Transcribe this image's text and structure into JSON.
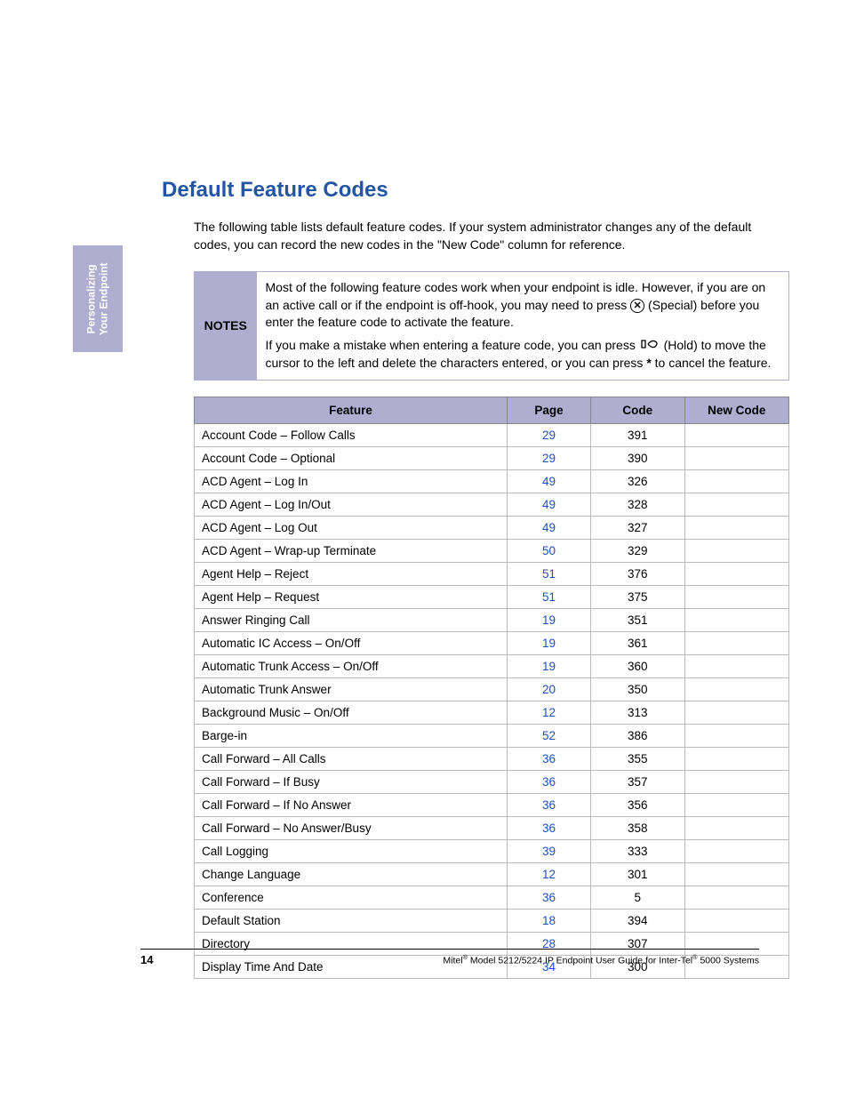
{
  "sideTab": {
    "line1": "Personalizing",
    "line2": "Your Endpoint"
  },
  "title": "Default Feature Codes",
  "intro": "The following table lists default feature codes. If your system administrator changes any of the default codes, you can record the new codes in the \"New Code\" column for reference.",
  "notes": {
    "label": "NOTES",
    "p1a": "Most of the following feature codes work when your endpoint is idle. However, if you are on an active call or if the endpoint is off-hook, you may need to press ",
    "p1b": " (Special) before you enter the feature code to activate the feature.",
    "p2a": "If you make a mistake when entering a feature code, you can press ",
    "p2b": " (Hold) to move the cursor to the left and delete the characters entered, or you can press ",
    "p2c": " to cancel the feature.",
    "star": "*"
  },
  "table": {
    "headers": {
      "feature": "Feature",
      "page": "Page",
      "code": "Code",
      "newCode": "New Code"
    },
    "rows": [
      {
        "feature": "Account Code – Follow Calls",
        "page": "29",
        "code": "391"
      },
      {
        "feature": "Account Code – Optional",
        "page": "29",
        "code": "390"
      },
      {
        "feature": "ACD Agent – Log In",
        "page": "49",
        "code": "326"
      },
      {
        "feature": "ACD Agent – Log In/Out",
        "page": "49",
        "code": "328"
      },
      {
        "feature": "ACD Agent – Log Out",
        "page": "49",
        "code": "327"
      },
      {
        "feature": "ACD Agent – Wrap-up Terminate",
        "page": "50",
        "code": "329"
      },
      {
        "feature": "Agent Help – Reject",
        "page": "51",
        "code": "376"
      },
      {
        "feature": "Agent Help – Request",
        "page": "51",
        "code": "375"
      },
      {
        "feature": "Answer Ringing Call",
        "page": "19",
        "code": "351"
      },
      {
        "feature": "Automatic IC Access – On/Off",
        "page": "19",
        "code": "361"
      },
      {
        "feature": "Automatic Trunk Access – On/Off",
        "page": "19",
        "code": "360"
      },
      {
        "feature": "Automatic Trunk Answer",
        "page": "20",
        "code": "350"
      },
      {
        "feature": "Background Music – On/Off",
        "page": "12",
        "code": "313"
      },
      {
        "feature": "Barge-in",
        "page": "52",
        "code": "386"
      },
      {
        "feature": "Call Forward – All Calls",
        "page": "36",
        "code": "355"
      },
      {
        "feature": "Call Forward – If Busy",
        "page": "36",
        "code": "357"
      },
      {
        "feature": "Call Forward – If No Answer",
        "page": "36",
        "code": "356"
      },
      {
        "feature": "Call Forward – No Answer/Busy",
        "page": "36",
        "code": "358"
      },
      {
        "feature": "Call Logging",
        "page": "39",
        "code": "333"
      },
      {
        "feature": "Change Language",
        "page": "12",
        "code": "301"
      },
      {
        "feature": "Conference",
        "page": "36",
        "code": "5"
      },
      {
        "feature": "Default Station",
        "page": "18",
        "code": "394"
      },
      {
        "feature": "Directory",
        "page": "28",
        "code": "307"
      },
      {
        "feature": "Display Time And Date",
        "page": "34",
        "code": "300"
      }
    ]
  },
  "footer": {
    "pageNumber": "14",
    "docPrefix": "Mitel",
    "docMid": " Model 5212/5224 IP Endpoint User Guide for Inter-Tel",
    "docSuffix": " 5000 Systems",
    "reg": "®"
  }
}
